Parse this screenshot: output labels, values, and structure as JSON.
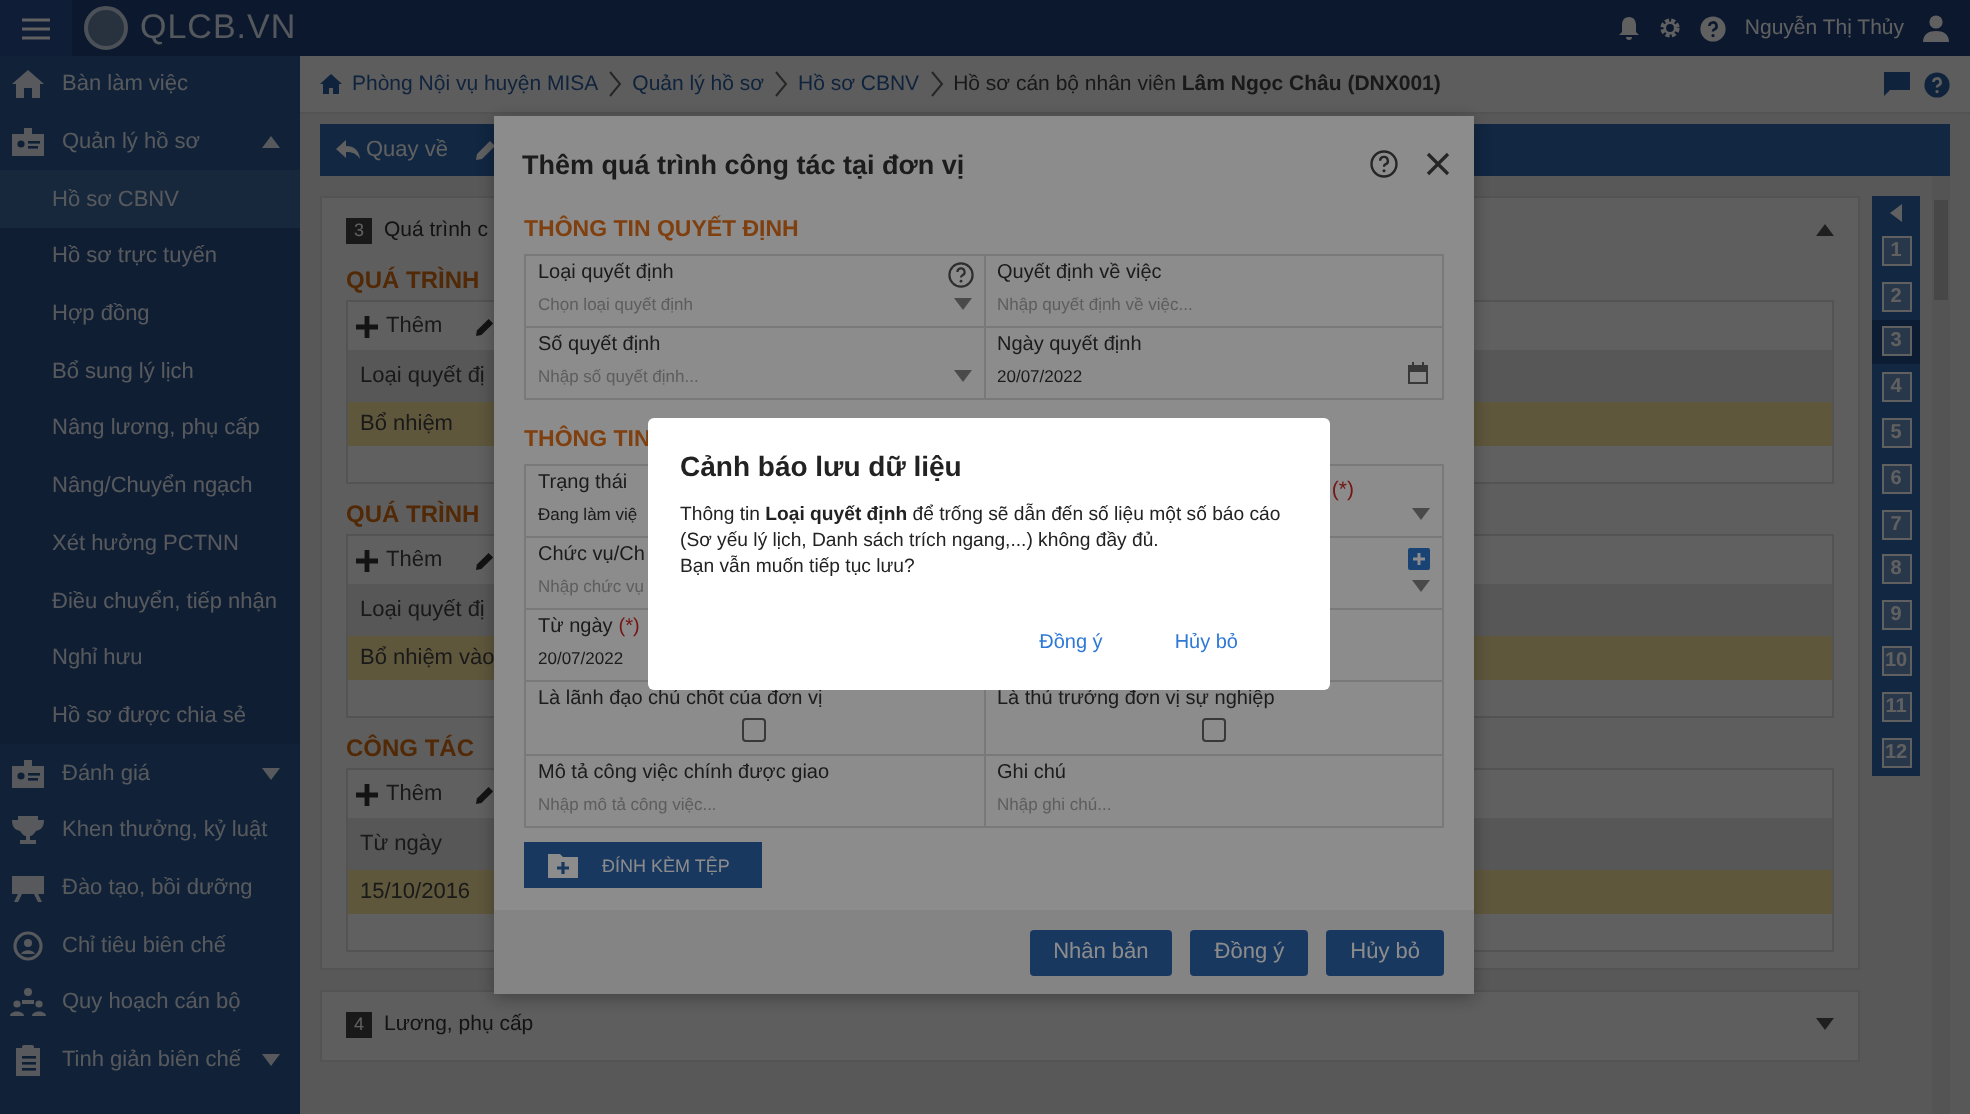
{
  "app": {
    "logo_text": "QLCB.VN",
    "user": "Nguyễn Thị Thủy"
  },
  "sidebar": {
    "items": [
      {
        "label": "Bàn làm việc"
      },
      {
        "label": "Quản lý hồ sơ",
        "expanded": true,
        "children": [
          {
            "label": "Hồ sơ CBNV",
            "selected": true
          },
          {
            "label": "Hồ sơ trực tuyến",
            "selected": false
          },
          {
            "label": "Hợp đồng",
            "selected": false
          },
          {
            "label": "Bổ sung lý lịch",
            "selected": false
          },
          {
            "label": "Nâng lương, phụ cấp",
            "selected": false
          },
          {
            "label": "Nâng/Chuyển ngạch",
            "selected": false
          },
          {
            "label": "Xét hưởng PCTNN",
            "selected": false
          },
          {
            "label": "Điều chuyển, tiếp nhận",
            "selected": false
          },
          {
            "label": "Nghỉ hưu",
            "selected": false
          },
          {
            "label": "Hồ sơ được chia sẻ",
            "selected": false
          }
        ]
      },
      {
        "label": "Đánh giá",
        "expanded": false
      },
      {
        "label": "Khen thưởng, kỷ luật"
      },
      {
        "label": "Đào tạo, bồi dưỡng"
      },
      {
        "label": "Chỉ tiêu biên chế"
      },
      {
        "label": "Quy hoạch cán bộ"
      },
      {
        "label": "Tinh giản biên chế",
        "expanded": false
      }
    ]
  },
  "breadcrumb": [
    "Phòng Nội vụ huyện MISA",
    "Quản lý hồ sơ",
    "Hồ sơ CBNV",
    "Hồ sơ cán bộ nhân viên **Lâm Ngọc Châu (DNX001)**"
  ],
  "toolbar": {
    "back": "Quay về"
  },
  "record": {
    "sections": [
      {
        "number": "3",
        "title": "Quá trình c",
        "expanded": true,
        "groups": [
          {
            "title": "QUÁ TRÌNH",
            "add": "Thêm",
            "column": "Loại quyết đị",
            "row": "Bổ nhiệm"
          },
          {
            "title": "QUÁ TRÌNH",
            "add": "Thêm",
            "column": "Loại quyết đị",
            "row": "Bổ nhiệm vào"
          },
          {
            "title": "CÔNG TÁC",
            "add": "Thêm",
            "column": "Từ ngày",
            "row": "15/10/2016"
          }
        ]
      },
      {
        "number": "4",
        "title": "Lương, phụ cấp",
        "expanded": false
      }
    ]
  },
  "section_nav": {
    "items": [
      {
        "label": "1",
        "selected": false
      },
      {
        "label": "2",
        "selected": false
      },
      {
        "label": "3",
        "selected": true
      },
      {
        "label": "4",
        "selected": false
      },
      {
        "label": "5",
        "selected": false
      },
      {
        "label": "6",
        "selected": false
      },
      {
        "label": "7",
        "selected": false
      },
      {
        "label": "8",
        "selected": false
      },
      {
        "label": "9",
        "selected": false
      },
      {
        "label": "10",
        "selected": false
      },
      {
        "label": "11",
        "selected": false
      },
      {
        "label": "12",
        "selected": false
      }
    ]
  },
  "modal": {
    "title": "Thêm quá trình công tác tại đơn vị",
    "sections": [
      {
        "title": "THÔNG TIN QUYẾT ĐỊNH",
        "fields": [
          {
            "kind": "select",
            "label": "Loại quyết định",
            "placeholder": "Chọn loại quyết định",
            "help": true
          },
          {
            "kind": "text",
            "label": "Quyết định về việc",
            "placeholder": "Nhập quyết định về việc..."
          },
          {
            "kind": "select",
            "label": "Số quyết định",
            "placeholder": "Nhập số quyết định..."
          },
          {
            "kind": "date",
            "label": "Ngày quyết định",
            "value": "20/07/2022"
          }
        ]
      },
      {
        "title": "THÔNG TIN",
        "fields": [
          {
            "kind": "text",
            "label": "Trạng thái",
            "value": "Đang làm việ"
          },
          {
            "kind": "select",
            "required_mark": "(*)"
          },
          {
            "kind": "text",
            "label": "Chức vụ/Ch",
            "placeholder": "Nhập chức vụ"
          },
          {
            "kind": "select",
            "addable": true
          },
          {
            "kind": "text",
            "label": "Từ ngày",
            "required_mark": "(*)",
            "value": "20/07/2022"
          },
          {
            "kind": "blank"
          },
          {
            "kind": "checkbox",
            "label": "Là lãnh đạo chủ chốt của đơn vị",
            "checked": false
          },
          {
            "kind": "checkbox",
            "label": "Là thủ trưởng đơn vị sự nghiệp",
            "checked": false
          },
          {
            "kind": "text",
            "label": "Mô tả công việc chính được giao",
            "placeholder": "Nhập mô tả công việc..."
          },
          {
            "kind": "text",
            "label": "Ghi chú",
            "placeholder": "Nhập ghi chú..."
          }
        ]
      }
    ],
    "attach": "ĐÍNH KÈM TỆP",
    "buttons": [
      "Nhân bản",
      "Đồng ý",
      "Hủy bỏ"
    ]
  },
  "alert": {
    "title": "Cảnh báo lưu dữ liệu",
    "message": "Thông tin **Loại quyết định** để trống sẽ dẫn đến số liệu một số báo cáo (Sơ yếu lý lịch, Danh sách trích ngang,...) không đầy đủ.",
    "question": "Bạn vẫn muốn tiếp tục lưu?",
    "buttons": [
      "Đồng ý",
      "Hủy bỏ"
    ]
  }
}
